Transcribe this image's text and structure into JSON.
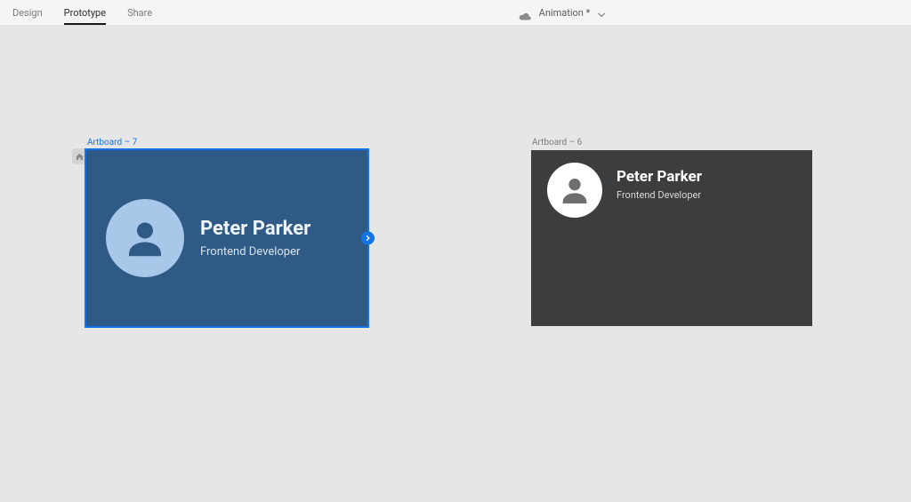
{
  "topbar": {
    "tabs": {
      "design": "Design",
      "prototype": "Prototype",
      "share": "Share"
    },
    "doc_title": "Animation *"
  },
  "canvas": {
    "artboard7": {
      "label": "Artboard – 7",
      "card": {
        "name": "Peter Parker",
        "role": "Frontend Developer"
      }
    },
    "artboard6": {
      "label": "Artboard – 6",
      "card": {
        "name": "Peter Parker",
        "role": "Frontend Developer"
      }
    }
  }
}
